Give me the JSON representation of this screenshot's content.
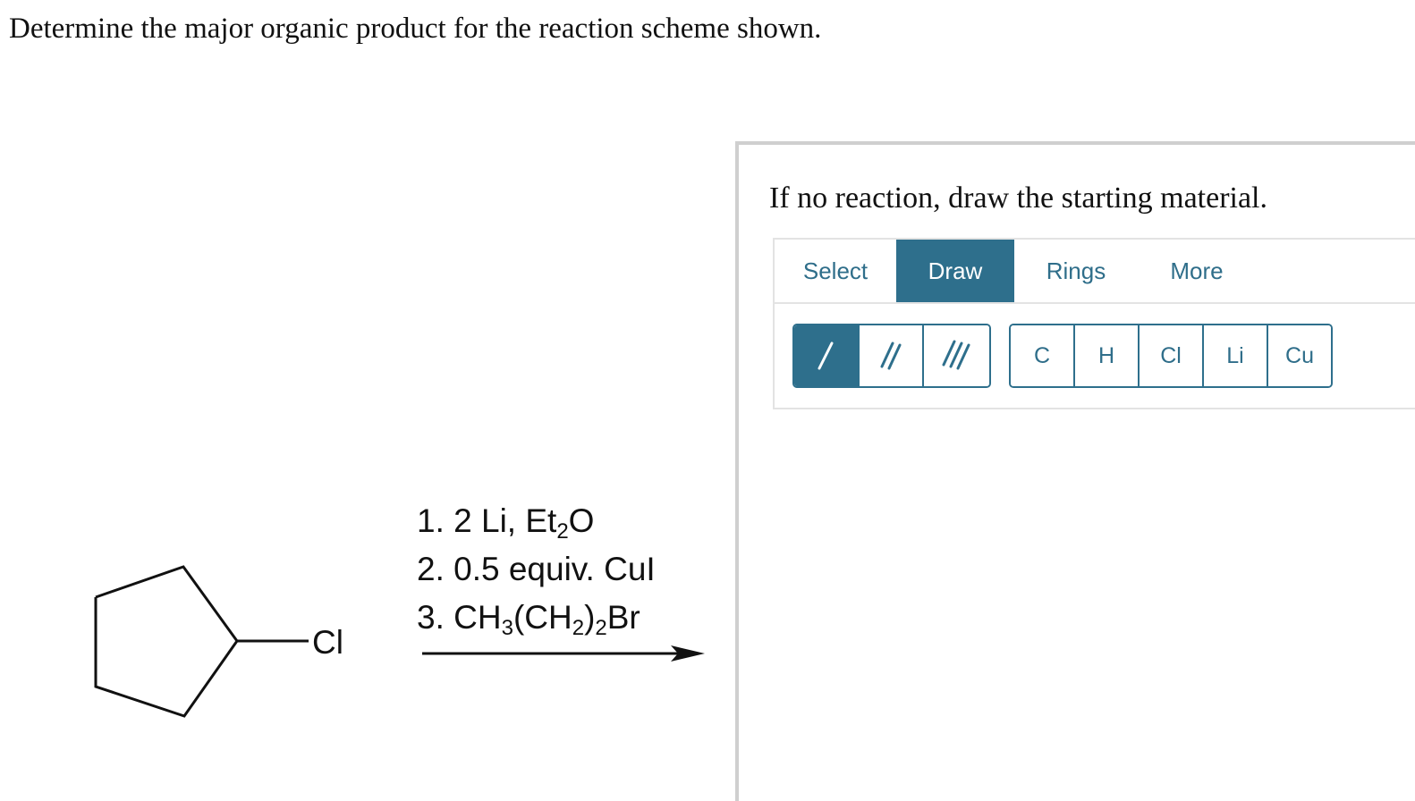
{
  "question": {
    "text": "Determine the major organic product for the reaction scheme shown."
  },
  "scheme": {
    "reagents": [
      {
        "prefix": "1. 2 Li, Et",
        "sub1": "2",
        "mid": "O",
        "sub2": "",
        "suffix": ""
      },
      {
        "prefix": "2. 0.5 equiv. CuI",
        "sub1": "",
        "mid": "",
        "sub2": "",
        "suffix": ""
      },
      {
        "prefix": "3. CH",
        "sub1": "3",
        "mid": "(CH",
        "sub2": "2",
        "suffix": ")"
      }
    ],
    "reagent3_tail_sub": "2",
    "reagent3_tail": "Br",
    "starting_material_substituent": "Cl"
  },
  "panel": {
    "instruction": "If no reaction, draw the starting material.",
    "tabs": [
      {
        "label": "Select",
        "active": false
      },
      {
        "label": "Draw",
        "active": true
      },
      {
        "label": "Rings",
        "active": false
      },
      {
        "label": "More",
        "active": false
      }
    ],
    "bond_tools": [
      {
        "name": "single-bond",
        "active": true
      },
      {
        "name": "double-bond",
        "active": false
      },
      {
        "name": "triple-bond",
        "active": false
      }
    ],
    "atoms": [
      "C",
      "H",
      "Cl",
      "Li",
      "Cu"
    ]
  },
  "colors": {
    "accent": "#2e6f8c",
    "tab_text": "#2f6e8a",
    "panel_border": "#cfcfcf"
  }
}
